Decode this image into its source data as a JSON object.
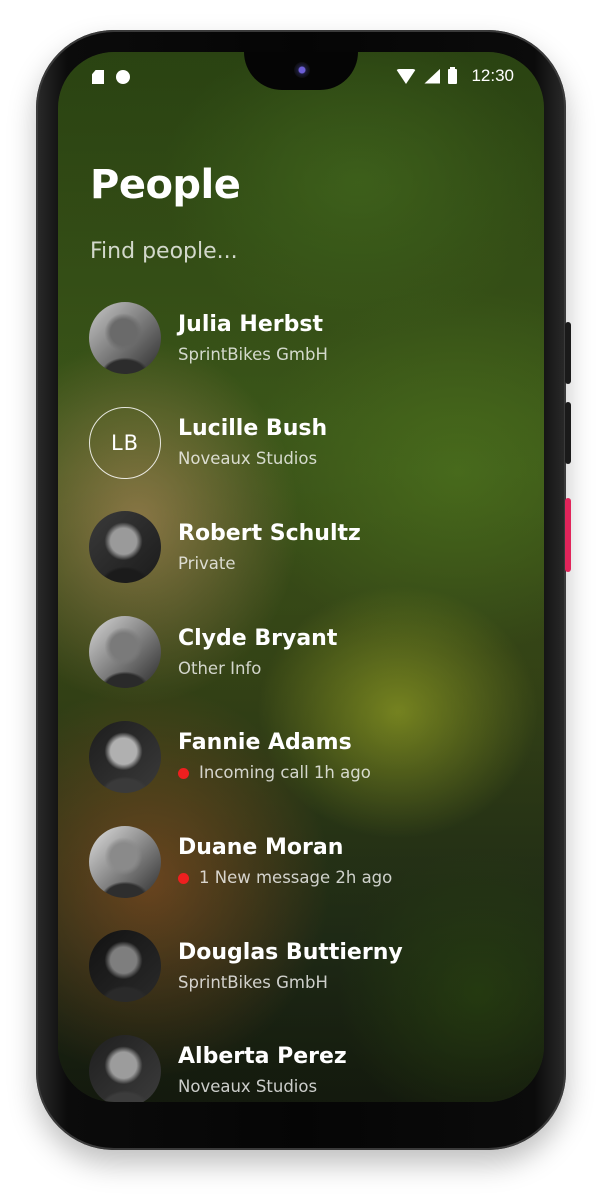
{
  "status_bar": {
    "time": "12:30",
    "icons": [
      "sim-icon",
      "record-dot-icon",
      "wifi-icon",
      "signal-icon",
      "battery-icon"
    ]
  },
  "header": {
    "title": "People"
  },
  "search": {
    "placeholder": "Find people...",
    "value": ""
  },
  "people": [
    {
      "name": "Julia Herbst",
      "subtitle": "SprintBikes GmbH",
      "avatar": "photo",
      "indicator": false
    },
    {
      "name": "Lucille Bush",
      "subtitle": "Noveaux Studios",
      "avatar": "initials",
      "initials": "LB",
      "indicator": false
    },
    {
      "name": "Robert Schultz",
      "subtitle": "Private",
      "avatar": "photo",
      "indicator": false
    },
    {
      "name": "Clyde Bryant",
      "subtitle": "Other Info",
      "avatar": "photo",
      "indicator": false
    },
    {
      "name": "Fannie Adams",
      "subtitle": "Incoming call 1h ago",
      "avatar": "photo",
      "indicator": true,
      "indicator_color": "#ee1f1f"
    },
    {
      "name": "Duane Moran",
      "subtitle": "1 New message 2h ago",
      "avatar": "photo",
      "indicator": true,
      "indicator_color": "#ee1f1f"
    },
    {
      "name": "Douglas Buttierny",
      "subtitle": "SprintBikes GmbH",
      "avatar": "photo",
      "indicator": false
    },
    {
      "name": "Alberta Perez",
      "subtitle": "Noveaux Studios",
      "avatar": "photo",
      "indicator": false
    }
  ],
  "colors": {
    "text_primary": "#ffffff",
    "notification_dot": "#ee1f1f",
    "device_accent_button": "#e1245a"
  }
}
